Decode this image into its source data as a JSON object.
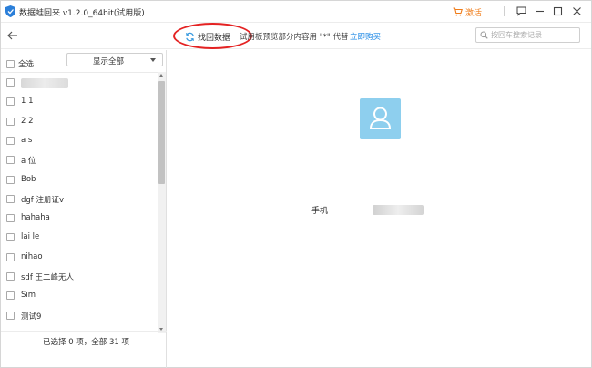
{
  "titlebar": {
    "app_title": "数据蛙回来 v1.2.0_64bit(试用版)",
    "activate_label": "激活"
  },
  "toolbar": {
    "recover_label": "找回数据",
    "trial_note": "试用板预览部分内容用 \"*\" 代替",
    "buy_label": "立即购买",
    "search_placeholder": "按回车搜索记录"
  },
  "sidebar": {
    "select_all_label": "全选",
    "filter_value": "显示全部",
    "contacts": [
      {
        "label": "",
        "hidden": true
      },
      {
        "label": "1 1"
      },
      {
        "label": "2 2"
      },
      {
        "label": "a s"
      },
      {
        "label": "a 位"
      },
      {
        "label": "Bob"
      },
      {
        "label": "dgf 注册证v"
      },
      {
        "label": "hahaha"
      },
      {
        "label": "lai le"
      },
      {
        "label": "nihao"
      },
      {
        "label": "sdf 王二峰无人"
      },
      {
        "label": "Sim"
      },
      {
        "label": "测试9"
      }
    ],
    "status": "已选择 0 项，全部 31 项"
  },
  "detail": {
    "field_label": "手机"
  },
  "colors": {
    "accent_orange": "#f07c19",
    "link_blue": "#1e88e5",
    "avatar_blue": "#8ecfee",
    "annotation_red": "#e42222"
  }
}
